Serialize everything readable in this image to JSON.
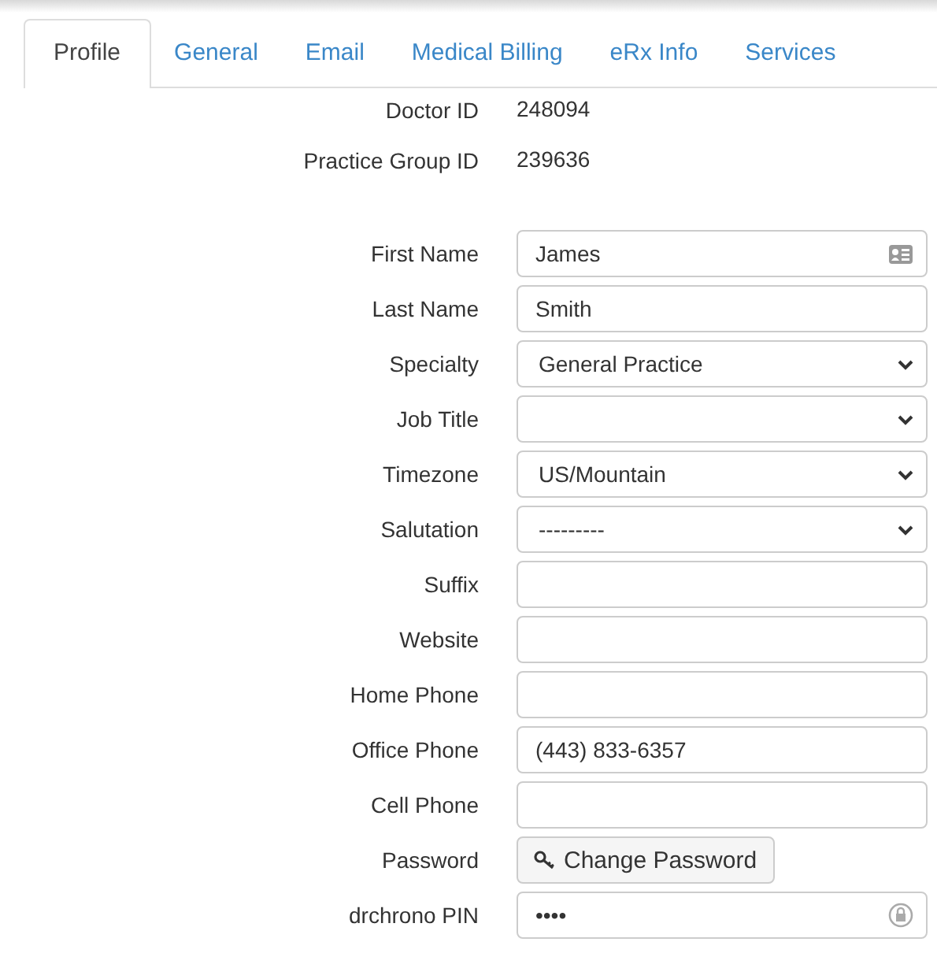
{
  "tabs": [
    {
      "label": "Profile",
      "selected": true
    },
    {
      "label": "General",
      "selected": false
    },
    {
      "label": "Email",
      "selected": false
    },
    {
      "label": "Medical Billing",
      "selected": false
    },
    {
      "label": "eRx Info",
      "selected": false
    },
    {
      "label": "Services",
      "selected": false
    }
  ],
  "fields": [
    {
      "kind": "static",
      "label": "Doctor ID",
      "value": "248094"
    },
    {
      "kind": "static",
      "label": "Practice Group ID",
      "value": "239636"
    },
    {
      "kind": "contact",
      "label": "First Name",
      "value": "James"
    },
    {
      "kind": "text",
      "label": "Last Name",
      "value": "Smith"
    },
    {
      "kind": "select",
      "label": "Specialty",
      "value": "General Practice"
    },
    {
      "kind": "select",
      "label": "Job Title"
    },
    {
      "kind": "select",
      "label": "Timezone",
      "value": "US/Mountain"
    },
    {
      "kind": "select",
      "label": "Salutation",
      "value": "---------"
    },
    {
      "kind": "text",
      "label": "Suffix"
    },
    {
      "kind": "text",
      "label": "Website"
    },
    {
      "kind": "text",
      "label": "Home Phone"
    },
    {
      "kind": "text",
      "label": "Office Phone",
      "value": "(443) 833-6357"
    },
    {
      "kind": "text",
      "label": "Cell Phone"
    },
    {
      "kind": "button",
      "label": "Password",
      "value": "Change Password"
    },
    {
      "kind": "pin",
      "label": "drchrono PIN",
      "value": "••••"
    }
  ]
}
